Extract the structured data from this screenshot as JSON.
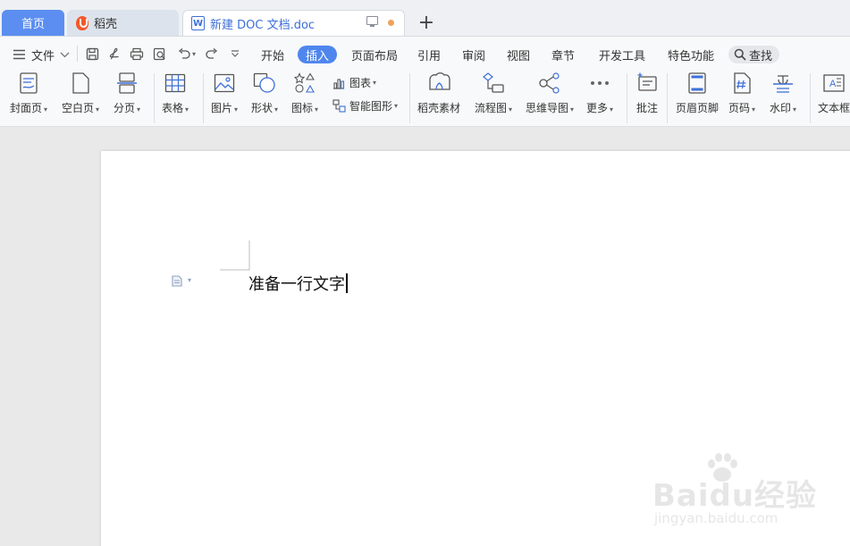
{
  "tabs": {
    "home": "首页",
    "daoke": "稻壳",
    "doc": "新建 DOC 文档.doc",
    "new_tab_symbol": "+"
  },
  "menu": {
    "file": "文件",
    "items": [
      "开始",
      "插入",
      "页面布局",
      "引用",
      "审阅",
      "视图",
      "章节",
      "开发工具",
      "特色功能"
    ],
    "active": "插入",
    "search": "查找"
  },
  "ribbon": {
    "cover": "封面页",
    "blank": "空白页",
    "page_break": "分页",
    "table": "表格",
    "picture": "图片",
    "shape": "形状",
    "icon": "图标",
    "chart": "图表",
    "smart_shape": "智能图形",
    "daoke_material": "稻壳素材",
    "flowchart": "流程图",
    "mindmap": "思维导图",
    "more": "更多",
    "comment": "批注",
    "header_footer": "页眉页脚",
    "page_number": "页码",
    "watermark": "水印",
    "textbox": "文本框"
  },
  "document": {
    "text": "准备一行文字"
  },
  "watermark": {
    "brand": "Baidu经验",
    "url": "jingyan.baidu.com"
  },
  "colors": {
    "accent": "#4f86ee",
    "home_tab": "#5b8ef0",
    "icon_blue": "#3d6fd8",
    "unsaved_dot": "#f0a25b"
  }
}
